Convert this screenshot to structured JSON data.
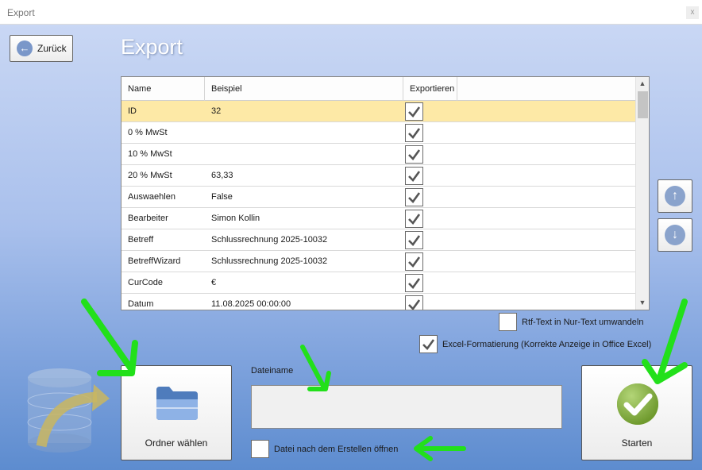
{
  "window": {
    "title": "Export",
    "close_glyph": "x"
  },
  "back_button": {
    "label": "Zurück",
    "icon": "arrow-left-icon"
  },
  "page_title": "Export",
  "table": {
    "columns": [
      "Name",
      "Beispiel",
      "Exportieren"
    ],
    "rows": [
      {
        "name": "ID",
        "example": "32",
        "export": true,
        "selected": true
      },
      {
        "name": "0 % MwSt",
        "example": "",
        "export": true
      },
      {
        "name": "10 % MwSt",
        "example": "",
        "export": true
      },
      {
        "name": "20 % MwSt",
        "example": "63,33",
        "export": true
      },
      {
        "name": "Auswaehlen",
        "example": "False",
        "export": true
      },
      {
        "name": "Bearbeiter",
        "example": "Simon Kollin",
        "export": true
      },
      {
        "name": "Betreff",
        "example": "Schlussrechnung 2025-10032",
        "export": true
      },
      {
        "name": "BetreffWizard",
        "example": "Schlussrechnung 2025-10032",
        "export": true
      },
      {
        "name": "CurCode",
        "example": "€",
        "export": true
      },
      {
        "name": "Datum",
        "example": "11.08.2025 00:00:00",
        "export": true
      }
    ]
  },
  "move_up": {
    "icon": "arrow-up-icon",
    "glyph": "↑"
  },
  "move_down": {
    "icon": "arrow-down-icon",
    "glyph": "↓"
  },
  "options": {
    "rtf_label": "Rtf-Text in Nur-Text umwandeln",
    "rtf_checked": false,
    "excel_label": "Excel-Formatierung (Korrekte Anzeige in Office Excel)",
    "excel_checked": true,
    "open_after_label": "Datei nach dem Erstellen öffnen",
    "open_after_checked": false
  },
  "folder_button": {
    "label": "Ordner wählen",
    "icon": "folder-icon"
  },
  "filename": {
    "label": "Dateiname",
    "value": ""
  },
  "start_button": {
    "label": "Starten",
    "icon": "checkmark-icon"
  },
  "colors": {
    "accent_green": "#22e01a",
    "selected_row": "#fde9a6"
  }
}
